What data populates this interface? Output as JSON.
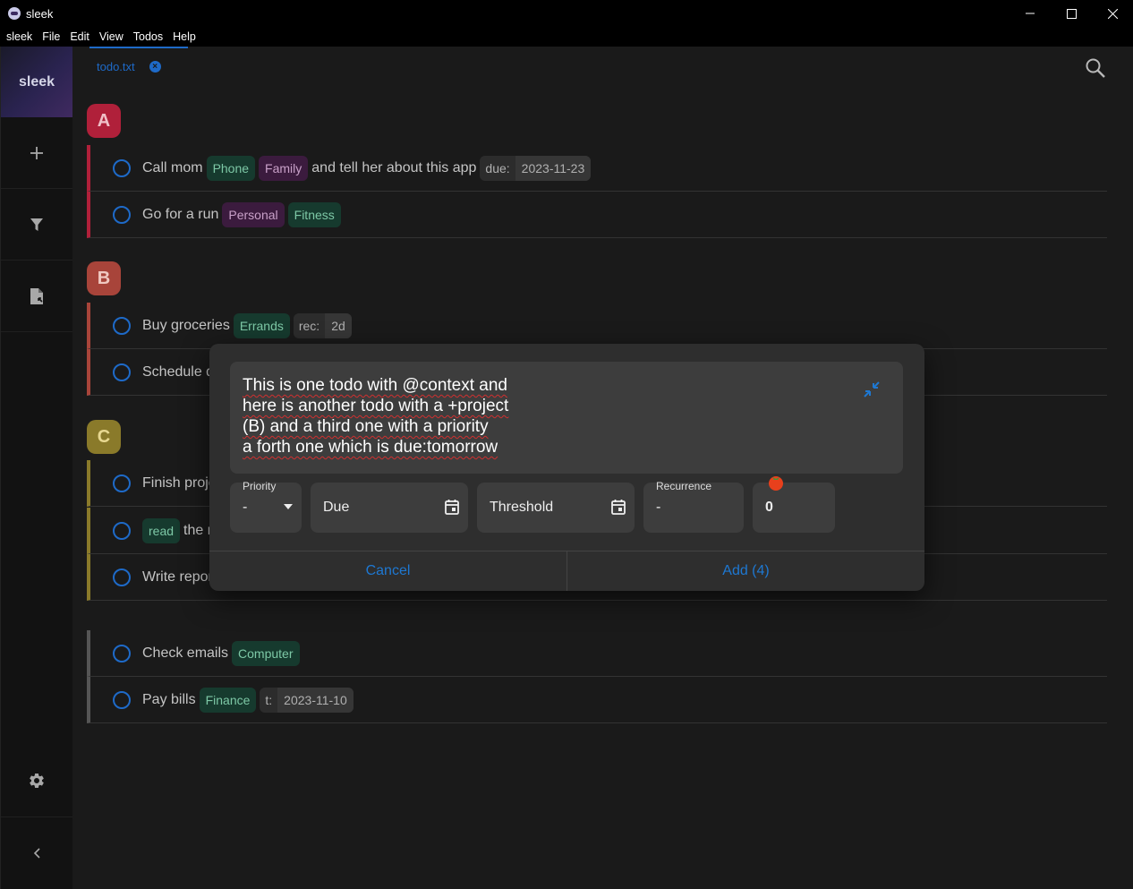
{
  "window": {
    "title": "sleek",
    "controls": [
      "minimize",
      "maximize",
      "close"
    ]
  },
  "menu": [
    "sleek",
    "File",
    "Edit",
    "View",
    "Todos",
    "Help"
  ],
  "sidebar": {
    "logo": "sleek"
  },
  "tabs": [
    {
      "label": "todo.txt"
    }
  ],
  "groups": [
    {
      "letter": "A",
      "color": "#b0203a",
      "todos": [
        {
          "text": "Call mom",
          "chips": [
            {
              "t": "Phone",
              "c": "green"
            },
            {
              "t": "Family",
              "c": "purple"
            }
          ],
          "after": "and tell her about this app",
          "kv": {
            "k": "due:",
            "v": "2023-11-23"
          }
        },
        {
          "text": "Go for a run",
          "chips": [
            {
              "t": "Personal",
              "c": "purple"
            },
            {
              "t": "Fitness",
              "c": "green"
            }
          ]
        }
      ]
    },
    {
      "letter": "B",
      "color": "#a8443a",
      "todos": [
        {
          "text": "Buy groceries",
          "chips": [
            {
              "t": "Errands",
              "c": "green"
            }
          ],
          "kv": {
            "k": "rec:",
            "v": "2d"
          }
        },
        {
          "text": "Schedule d"
        }
      ]
    },
    {
      "letter": "C",
      "color": "#8a7a2a",
      "todos": [
        {
          "text": "Finish proje"
        },
        {
          "pre_chip": "read",
          "text": "the r"
        },
        {
          "text": "Write repor"
        }
      ]
    },
    {
      "letter": "",
      "color": "#555555",
      "todos": [
        {
          "text": "Check emails",
          "chips": [
            {
              "t": "Computer",
              "c": "green"
            }
          ]
        },
        {
          "text": "Pay bills",
          "chips": [
            {
              "t": "Finance",
              "c": "green"
            }
          ],
          "kv": {
            "k": "t:",
            "v": "2023-11-10"
          }
        }
      ]
    }
  ],
  "dialog": {
    "lines": [
      "This is one todo with @context and",
      "here is another todo with a +project",
      "(B) and a third one with a priority",
      "a forth one which is due:tomorrow"
    ],
    "priority": {
      "label": "Priority",
      "value": "-"
    },
    "due": {
      "placeholder": "Due"
    },
    "threshold": {
      "placeholder": "Threshold"
    },
    "recurrence": {
      "label": "Recurrence",
      "value": "-"
    },
    "pomodoro": {
      "value": "0"
    },
    "cancel": "Cancel",
    "add": "Add (4)"
  }
}
